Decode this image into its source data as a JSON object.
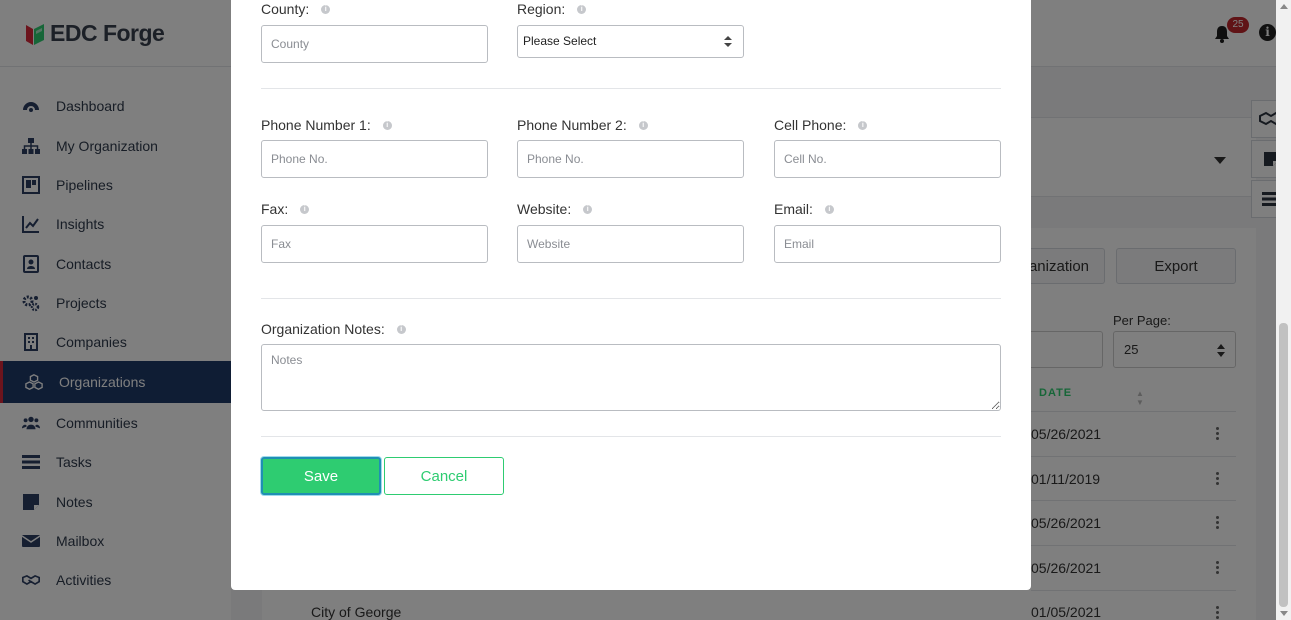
{
  "app": {
    "brand": "EDC Forge",
    "notification_count": "25",
    "info_glyph": "i"
  },
  "sidebar": {
    "items": [
      {
        "label": "Dashboard",
        "icon": "dashboard-icon"
      },
      {
        "label": "My Organization",
        "icon": "org-chart-icon"
      },
      {
        "label": "Pipelines",
        "icon": "pipeline-icon"
      },
      {
        "label": "Insights",
        "icon": "line-chart-icon"
      },
      {
        "label": "Contacts",
        "icon": "contact-card-icon"
      },
      {
        "label": "Projects",
        "icon": "gears-icon"
      },
      {
        "label": "Companies",
        "icon": "building-icon"
      },
      {
        "label": "Organizations",
        "icon": "cubes-icon",
        "active": true
      },
      {
        "label": "Communities",
        "icon": "users-icon"
      },
      {
        "label": "Tasks",
        "icon": "tasks-icon"
      },
      {
        "label": "Notes",
        "icon": "note-icon"
      },
      {
        "label": "Mailbox",
        "icon": "envelope-icon"
      },
      {
        "label": "Activities",
        "icon": "handshake-icon"
      }
    ]
  },
  "background": {
    "add_org_partial": "anization",
    "export_label": "Export",
    "per_page_label": "Per Page:",
    "per_page_value": "25",
    "date_column": "DATE",
    "dates": [
      "05/26/2021",
      "01/11/2019",
      "05/26/2021",
      "05/26/2021",
      "01/05/2021"
    ],
    "last_row_name": "City of George"
  },
  "modal": {
    "county": {
      "label": "County:",
      "placeholder": "County"
    },
    "region": {
      "label": "Region:",
      "value": "Please Select"
    },
    "phone1": {
      "label": "Phone Number 1:",
      "placeholder": "Phone No."
    },
    "phone2": {
      "label": "Phone Number 2:",
      "placeholder": "Phone No."
    },
    "cell": {
      "label": "Cell Phone:",
      "placeholder": "Cell No."
    },
    "fax": {
      "label": "Fax:",
      "placeholder": "Fax"
    },
    "website": {
      "label": "Website:",
      "placeholder": "Website"
    },
    "email": {
      "label": "Email:",
      "placeholder": "Email"
    },
    "notes": {
      "label": "Organization Notes:",
      "placeholder": "Notes"
    },
    "info_glyph": "i",
    "save_label": "Save",
    "cancel_label": "Cancel"
  },
  "colors": {
    "primary_green": "#2ecc71",
    "sidebar_active": "#1f3a68",
    "accent_red": "#d8283a"
  }
}
